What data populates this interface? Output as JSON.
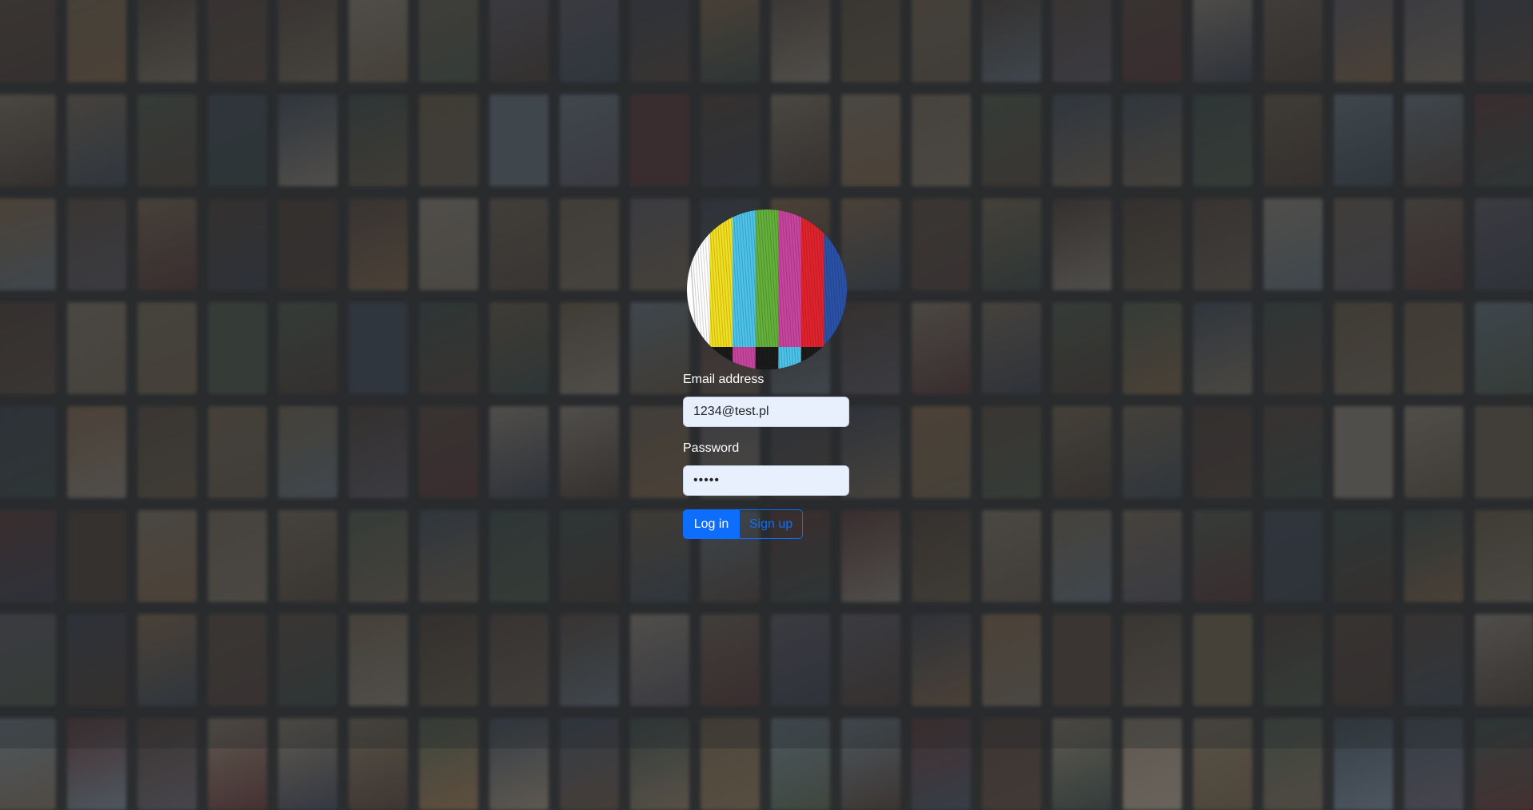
{
  "form": {
    "email_label": "Email address",
    "email_value": "1234@test.pl",
    "password_label": "Password",
    "password_value": "•••••",
    "login_button": "Log in",
    "signup_button": "Sign up"
  },
  "logo": {
    "icon": "tv-color-bars-icon",
    "bar_colors": [
      "#ffffff",
      "#f2e020",
      "#4cc3ea",
      "#63b13a",
      "#c8459f",
      "#e2232d",
      "#2a52a8"
    ]
  },
  "colors": {
    "background": "#2b2d2f",
    "primary": "#0d6efd",
    "input_fill": "#e8f0fe",
    "poster_palette": [
      "#5b4a3e",
      "#3f4b5a",
      "#6e6152",
      "#4c3d34",
      "#7a6a50",
      "#3a4a46",
      "#5e5a66",
      "#8a7d6a",
      "#4a3b33",
      "#6b5b44",
      "#3c4150",
      "#7d6e5a",
      "#55443b",
      "#6a7a86",
      "#8b6b4a",
      "#4e5b4a",
      "#9a8f80",
      "#5a3434"
    ]
  }
}
